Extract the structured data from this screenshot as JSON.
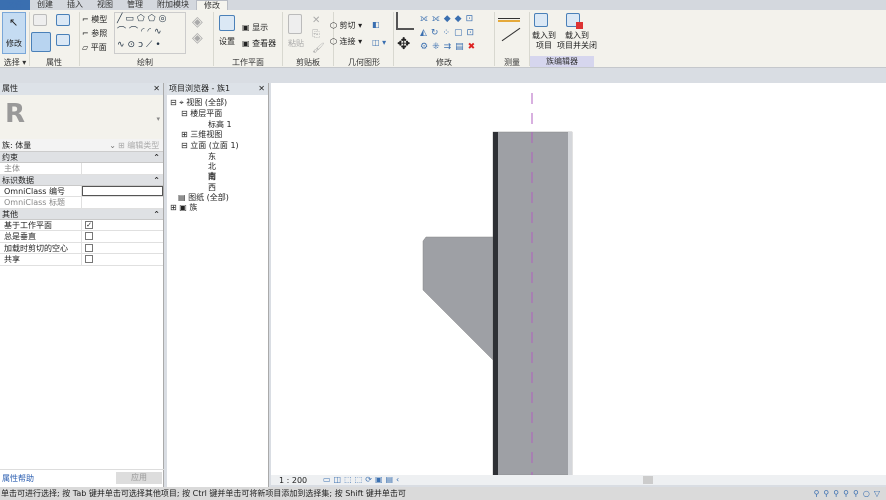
{
  "tabs": [
    "文件",
    "创建",
    "插入",
    "视图",
    "管理",
    "附加模块",
    "修改"
  ],
  "active_tab": "修改",
  "ribbon": {
    "modify": "修改",
    "select": "选择 ▾",
    "properties": "属性",
    "draw": {
      "label": "绘制",
      "model": "模型",
      "reference": "参照",
      "plane": "平面"
    },
    "workplane": {
      "label": "工作平面",
      "set": "设置",
      "show": "显示",
      "viewer": "查看器"
    },
    "clipboard": {
      "label": "剪贴板",
      "paste": "粘贴"
    },
    "geometry": {
      "label": "几何图形",
      "cut": "剪切",
      "join": "连接"
    },
    "modify_panel": "修改",
    "measure": "测量",
    "family_editor": {
      "label": "族编辑器",
      "load_project": "载入到\n项目",
      "load_close": "载入到\n项目并关闭"
    }
  },
  "properties": {
    "title": "属性",
    "type": "族: 体量",
    "edit_type": "编辑类型",
    "groups": [
      {
        "name": "约束",
        "rows": [
          {
            "k": "主体",
            "v": ""
          }
        ]
      },
      {
        "name": "标识数据",
        "rows": [
          {
            "k": "OmniClass 编号",
            "v": ""
          },
          {
            "k": "OmniClass 标题",
            "v": ""
          }
        ]
      },
      {
        "name": "其他",
        "rows": [
          {
            "k": "基于工作平面",
            "checked": true
          },
          {
            "k": "总是垂直",
            "checked": false
          },
          {
            "k": "加载时剪切的空心",
            "checked": false
          },
          {
            "k": "共享",
            "checked": false
          }
        ]
      }
    ],
    "help": "属性帮助",
    "apply": "应用"
  },
  "browser": {
    "title": "项目浏览器 - 族1",
    "nodes": [
      "视图 (全部)",
      "楼层平面",
      "标高 1",
      "三维视图",
      "立面 (立面 1)",
      "东",
      "北",
      "南",
      "西",
      "图纸 (全部)",
      "族"
    ]
  },
  "view": {
    "scale": "1 : 200"
  },
  "status": "单击可进行选择; 按 Tab 键并单击可选择其他项目; 按 Ctrl 键并单击可将新项目添加到选择集; 按 Shift 键并单击可",
  "colors": {
    "accent": "#4a80b8",
    "element": "#9ea0a5",
    "refplane": "#b060c0"
  }
}
